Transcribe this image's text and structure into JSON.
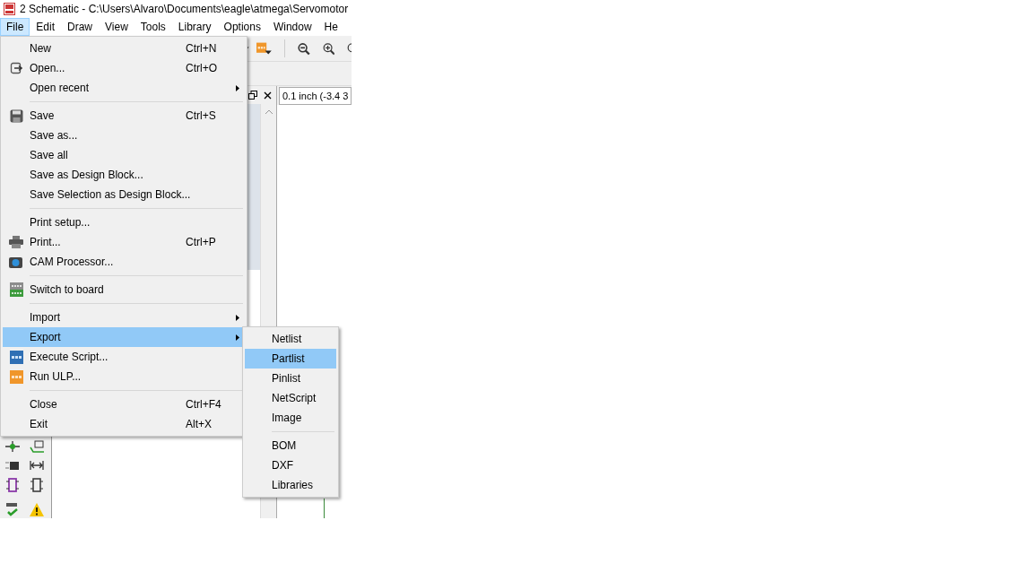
{
  "window": {
    "title": "2 Schematic - C:\\Users\\Alvaro\\Documents\\eagle\\atmega\\Servomotor"
  },
  "menubar": [
    {
      "label": "File",
      "selected": true
    },
    {
      "label": "Edit",
      "selected": false
    },
    {
      "label": "Draw",
      "selected": false
    },
    {
      "label": "View",
      "selected": false
    },
    {
      "label": "Tools",
      "selected": false
    },
    {
      "label": "Library",
      "selected": false
    },
    {
      "label": "Options",
      "selected": false
    },
    {
      "label": "Window",
      "selected": false
    },
    {
      "label": "He",
      "selected": false
    }
  ],
  "file_menu": [
    {
      "kind": "item",
      "label": "New",
      "shortcut": "Ctrl+N",
      "submenu": false,
      "selected": false
    },
    {
      "kind": "item",
      "label": "Open...",
      "shortcut": "Ctrl+O",
      "submenu": false,
      "selected": false
    },
    {
      "kind": "item",
      "label": "Open recent",
      "submenu": true,
      "selected": false
    },
    {
      "kind": "separator"
    },
    {
      "kind": "item",
      "label": "Save",
      "shortcut": "Ctrl+S",
      "submenu": false,
      "selected": false
    },
    {
      "kind": "item",
      "label": "Save as...",
      "submenu": false,
      "selected": false
    },
    {
      "kind": "item",
      "label": "Save all",
      "submenu": false,
      "selected": false
    },
    {
      "kind": "item",
      "label": "Save as Design Block...",
      "submenu": false,
      "selected": false
    },
    {
      "kind": "item",
      "label": "Save Selection as Design Block...",
      "submenu": false,
      "selected": false
    },
    {
      "kind": "separator"
    },
    {
      "kind": "item",
      "label": "Print setup...",
      "submenu": false,
      "selected": false
    },
    {
      "kind": "item",
      "label": "Print...",
      "shortcut": "Ctrl+P",
      "submenu": false,
      "selected": false
    },
    {
      "kind": "item",
      "label": "CAM Processor...",
      "submenu": false,
      "selected": false
    },
    {
      "kind": "separator"
    },
    {
      "kind": "item",
      "label": "Switch to board",
      "submenu": false,
      "selected": false
    },
    {
      "kind": "separator"
    },
    {
      "kind": "item",
      "label": "Import",
      "submenu": true,
      "selected": false
    },
    {
      "kind": "item",
      "label": "Export",
      "submenu": true,
      "selected": true
    },
    {
      "kind": "item",
      "label": "Execute Script...",
      "submenu": false,
      "selected": false
    },
    {
      "kind": "item",
      "label": "Run ULP...",
      "submenu": false,
      "selected": false
    },
    {
      "kind": "separator"
    },
    {
      "kind": "item",
      "label": "Close",
      "shortcut": "Ctrl+F4",
      "submenu": false,
      "selected": false
    },
    {
      "kind": "item",
      "label": "Exit",
      "shortcut": "Alt+X",
      "submenu": false,
      "selected": false
    }
  ],
  "export_submenu": [
    {
      "kind": "item",
      "label": "Netlist",
      "selected": false
    },
    {
      "kind": "item",
      "label": "Partlist",
      "selected": true
    },
    {
      "kind": "item",
      "label": "Pinlist",
      "selected": false
    },
    {
      "kind": "item",
      "label": "NetScript",
      "selected": false
    },
    {
      "kind": "item",
      "label": "Image",
      "selected": false
    },
    {
      "kind": "separator"
    },
    {
      "kind": "item",
      "label": "BOM",
      "selected": false
    },
    {
      "kind": "item",
      "label": "DXF",
      "selected": false
    },
    {
      "kind": "item",
      "label": "Libraries",
      "selected": false
    }
  ],
  "coordinate_field": {
    "value": "0.1 inch (-3.4 3"
  }
}
